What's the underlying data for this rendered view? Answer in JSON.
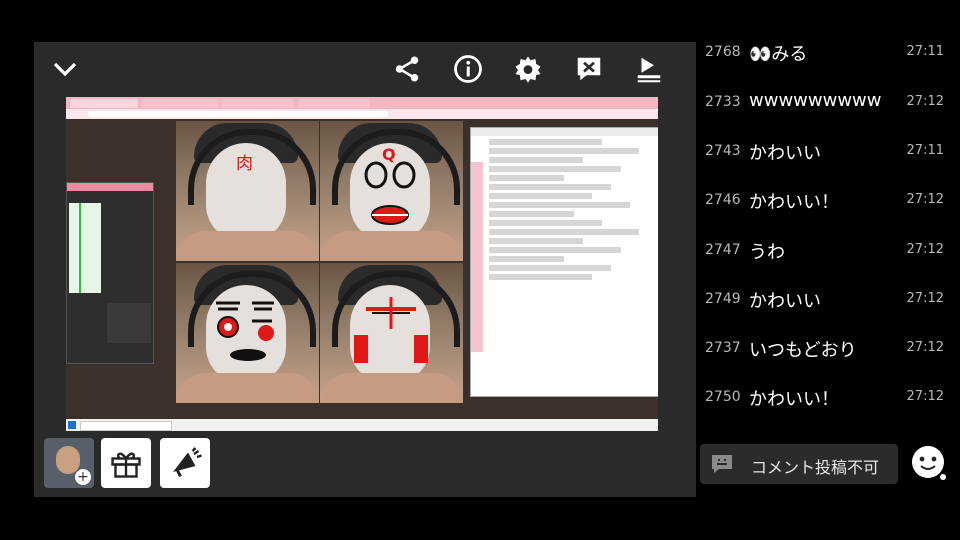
{
  "controls": {
    "collapse_icon": "chevron-down-icon",
    "share_icon": "share-icon",
    "info_icon": "info-icon",
    "settings_icon": "gear-icon",
    "comment_hide_icon": "comment-off-icon",
    "playlist_icon": "playlist-icon"
  },
  "comments": [
    {
      "num": "2768",
      "text": "👀みる",
      "time": "27:11"
    },
    {
      "num": "2733",
      "text": "wwwwwwwww",
      "time": "27:12"
    },
    {
      "num": "2743",
      "text": "かわいい",
      "time": "27:11"
    },
    {
      "num": "2746",
      "text": "かわいい！",
      "time": "27:12"
    },
    {
      "num": "2747",
      "text": "うわ",
      "time": "27:12"
    },
    {
      "num": "2749",
      "text": "かわいい",
      "time": "27:12"
    },
    {
      "num": "2737",
      "text": "いつもどおり",
      "time": "27:12"
    },
    {
      "num": "2750",
      "text": "かわいい！",
      "time": "27:12"
    }
  ],
  "comment_input": {
    "label": "コメント投稿不可"
  },
  "stream_overlay": {
    "doodle_text_1": "肉",
    "doodle_text_2": "Q"
  },
  "colors": {
    "background": "#000000",
    "player": "#2a2a2a",
    "doodle_red": "#e01818"
  }
}
